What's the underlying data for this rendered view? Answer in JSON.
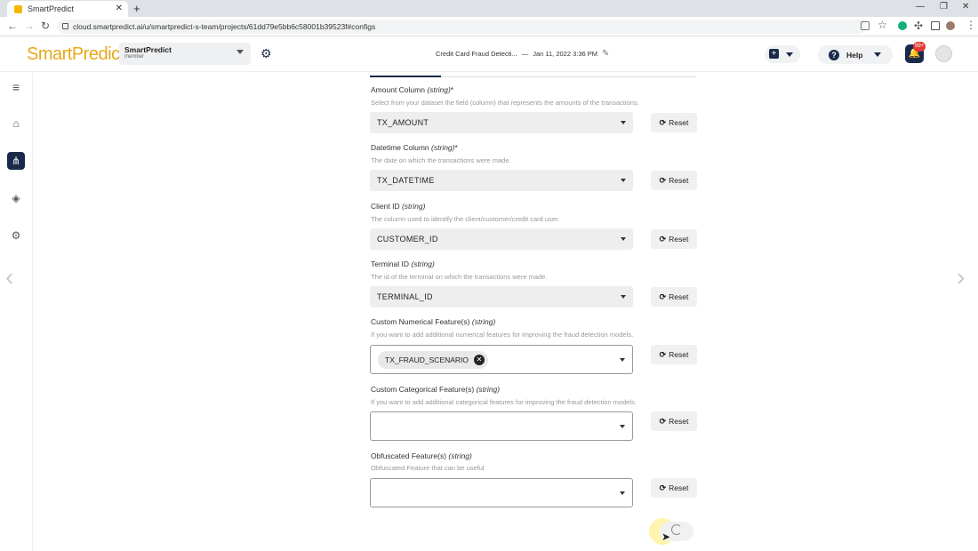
{
  "browser": {
    "tab_title": "SmartPredict",
    "url": "cloud.smartpredict.ai/u/smartpredict-s-team/projects/61dd79e5bb6c58001b39523f#configs"
  },
  "header": {
    "logo_text": "SmartPredict",
    "org_name": "SmartPredict",
    "org_role": "member",
    "project_title": "Credit Card Fraud Detecti...",
    "project_date": "Jan 11, 2022 3:36 PM",
    "help_label": "Help",
    "notif_badge": "99+"
  },
  "fields": [
    {
      "label": "Amount Column",
      "type": "(string)",
      "required": "*",
      "desc": "Select from your dataset the field (column) that represents the amounts of the transactions.",
      "value": "TX_AMOUNT",
      "reset": "Reset"
    },
    {
      "label": "Datetime Column",
      "type": "(string)",
      "required": "*",
      "desc": "The date on which the transactions were made.",
      "value": "TX_DATETIME",
      "reset": "Reset"
    },
    {
      "label": "Client ID",
      "type": "(string)",
      "required": "",
      "desc": "The column used to identify the client/customer/credit card user.",
      "value": "CUSTOMER_ID",
      "reset": "Reset"
    },
    {
      "label": "Terminal ID",
      "type": "(string)",
      "required": "",
      "desc": "The id of the terminal on which the transactions were made.",
      "value": "TERMINAL_ID",
      "reset": "Reset"
    },
    {
      "label": "Custom Numerical Feature(s)",
      "type": "(string)",
      "required": "",
      "desc": "If you want to add additional numerical features for improving the fraud detection models.",
      "chip": "TX_FRAUD_SCENARIO",
      "reset": "Reset"
    },
    {
      "label": "Custom Categorical Feature(s)",
      "type": "(string)",
      "required": "",
      "desc": "If you want to add additional categorical features for improving the fraud detection models.",
      "reset": "Reset"
    },
    {
      "label": "Obfuscated Feature(s)",
      "type": "(string)",
      "required": "",
      "desc": "Obfuscated Feature that can be useful",
      "reset": "Reset"
    }
  ],
  "colors": {
    "brand": "#e7a91a",
    "navy": "#1a2a4a"
  }
}
